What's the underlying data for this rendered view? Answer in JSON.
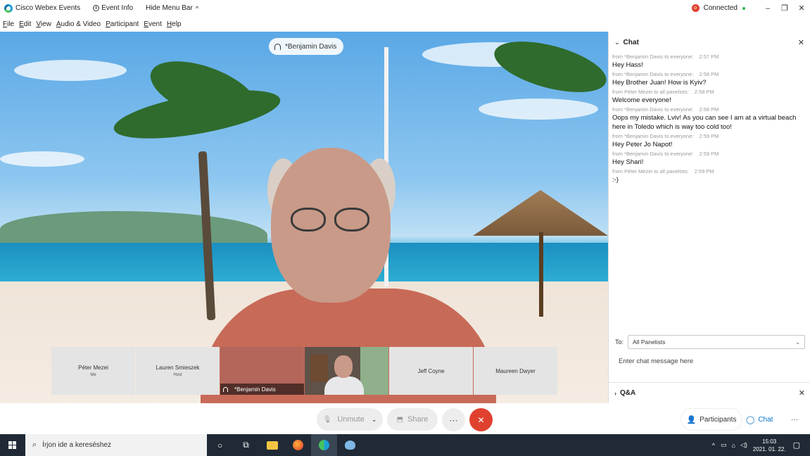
{
  "titlebar": {
    "app_title": "Cisco Webex Events",
    "event_info": "Event Info",
    "hide_menu": "Hide Menu Bar",
    "hide_menu_chevron": "^",
    "connection_status": "Connected",
    "minimize": "–",
    "restore": "❐",
    "close": "✕"
  },
  "menu": [
    "File",
    "Edit",
    "View",
    "Audio & Video",
    "Participant",
    "Event",
    "Help"
  ],
  "active_speaker": "*Benjamin Davis",
  "filmstrip": [
    {
      "name": "Péter Mezei",
      "role": "Me"
    },
    {
      "name": "Lauren Smieszek",
      "role": "Host"
    },
    {
      "name": "*Benjamin Davis",
      "role": ""
    },
    {
      "name": "Jeff Coyne",
      "role": ""
    },
    {
      "name": "Maureen Dwyer",
      "role": ""
    }
  ],
  "controls": {
    "unmute": "Unmute",
    "share": "Share",
    "more": "···",
    "end": "✕",
    "participants": "Participants",
    "chat": "Chat",
    "more_right": "···"
  },
  "chat": {
    "title": "Chat",
    "messages": [
      {
        "from": "from *Benjamin Davis to everyone:",
        "time": "2:57 PM",
        "text": "Hey Hass!"
      },
      {
        "from": "from *Benjamin Davis to everyone:",
        "time": "2:58 PM",
        "text": "Hey Brother Juan! How is Kyiv?"
      },
      {
        "from": "from Péter Mezei to all panelists:",
        "time": "2:58 PM",
        "text": "Welcome everyone!"
      },
      {
        "from": "from *Benjamin Davis to everyone:",
        "time": "2:58 PM",
        "text": "Oops my mistake.  Lviv!  As you can see I am at a virtual beach here in Toledo which is way too cold too!"
      },
      {
        "from": "from *Benjamin Davis to everyone:",
        "time": "2:59 PM",
        "text": "Hey Peter Jo Napot!"
      },
      {
        "from": "from *Benjamin Davis to everyone:",
        "time": "2:59 PM",
        "text": "Hey Shari!"
      },
      {
        "from": "from Péter Mezei to all panelists:",
        "time": "2:59 PM",
        "text": ":-)"
      }
    ],
    "to_label": "To:",
    "to_value": "All Panelists",
    "input_placeholder": "Enter chat message here",
    "qa_title": "Q&A"
  },
  "taskbar": {
    "search_placeholder": "Írjon ide a kereséshez",
    "time": "15:03",
    "date": "2021. 01. 22."
  },
  "colors": {
    "end_button": "#e0412f",
    "connected_dot": "#2eb84d",
    "chat_accent": "#0a74c9"
  }
}
